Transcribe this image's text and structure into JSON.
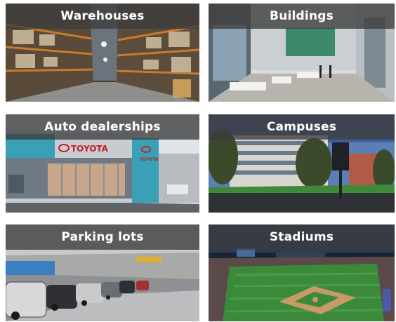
{
  "tiles": [
    {
      "label": "Warehouses"
    },
    {
      "label": "Buildings"
    },
    {
      "label": "Auto dealerships"
    },
    {
      "label": "Campuses"
    },
    {
      "label": "Parking lots"
    },
    {
      "label": "Stadiums"
    }
  ],
  "signage": {
    "auto_brand_main": "TOYOTA",
    "auto_brand_side": "TOYOTA"
  }
}
